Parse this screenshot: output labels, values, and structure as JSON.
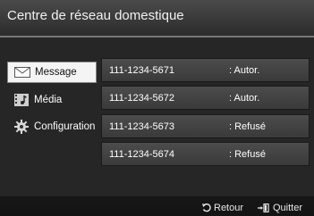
{
  "header": {
    "title": "Centre de réseau domestique"
  },
  "sidebar": {
    "items": [
      {
        "label": "Message",
        "icon": "envelope-icon",
        "selected": true
      },
      {
        "label": "Média",
        "icon": "film-music-icon",
        "selected": false
      },
      {
        "label": "Configuration",
        "icon": "gear-icon",
        "selected": false
      }
    ]
  },
  "devices": [
    {
      "number": "111-1234-5671",
      "status": ": Autor."
    },
    {
      "number": "111-1234-5672",
      "status": ": Autor."
    },
    {
      "number": "111-1234-5673",
      "status": ": Refusé"
    },
    {
      "number": "111-1234-5674",
      "status": ": Refusé"
    }
  ],
  "footer": {
    "back_label": "Retour",
    "exit_label": "Quitter"
  }
}
